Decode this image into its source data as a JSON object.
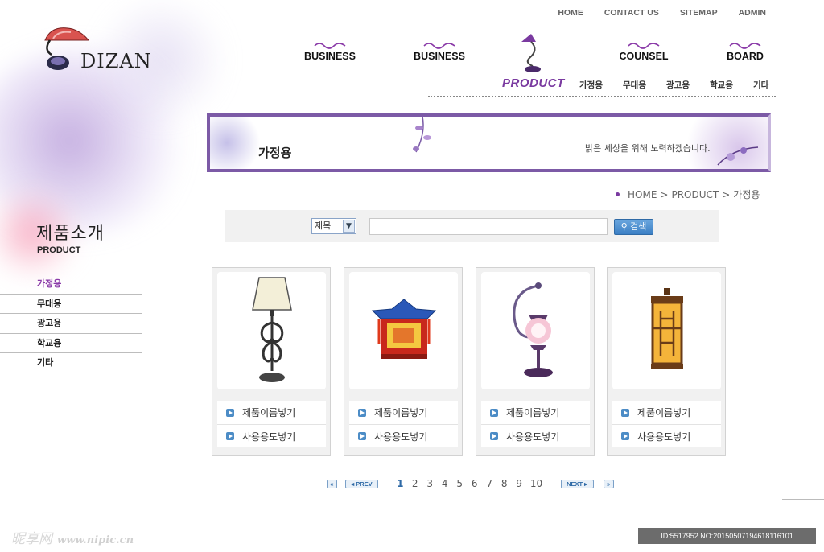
{
  "brand": {
    "name": "DIZAN"
  },
  "util_nav": [
    "HOME",
    "CONTACT US",
    "SITEMAP",
    "ADMIN"
  ],
  "main_nav": [
    "BUSINESS",
    "BUSINESS",
    "COUNSEL",
    "BOARD"
  ],
  "product_nav": {
    "label": "PRODUCT",
    "subitems": [
      "가정용",
      "무대용",
      "광고용",
      "학교용",
      "기타"
    ]
  },
  "banner": {
    "title": "가정용",
    "slogan": "밝은 세상을 위해 노력하겠습니다."
  },
  "breadcrumb": [
    "HOME",
    ">",
    "PRODUCT",
    ">",
    "가정용"
  ],
  "search": {
    "select_value": "제목",
    "button_label": "검색"
  },
  "sidebar": {
    "title": "제품소개",
    "subtitle": "PRODUCT",
    "items": [
      {
        "label": "가정용",
        "active": true
      },
      {
        "label": "무대용",
        "active": false
      },
      {
        "label": "광고용",
        "active": false
      },
      {
        "label": "학교용",
        "active": false
      },
      {
        "label": "기타",
        "active": false
      }
    ]
  },
  "products": [
    {
      "name": "제품이름넣기",
      "usage": "사용용도넣기",
      "icon": "floor-lamp-icon"
    },
    {
      "name": "제품이름넣기",
      "usage": "사용용도넣기",
      "icon": "lantern-icon"
    },
    {
      "name": "제품이름넣기",
      "usage": "사용용도넣기",
      "icon": "hanging-lamp-icon"
    },
    {
      "name": "제품이름넣기",
      "usage": "사용용도넣기",
      "icon": "wooden-lantern-icon"
    }
  ],
  "pagination": {
    "prev": "PREV",
    "next": "NEXT",
    "pages": [
      "1",
      "2",
      "3",
      "4",
      "5",
      "6",
      "7",
      "8",
      "9",
      "10"
    ],
    "current": "1"
  },
  "watermark": {
    "left": "昵享网",
    "left_url": "www.nipic.cn",
    "right": "ID:5517952 NO:20150507194618116101"
  },
  "colors": {
    "accent": "#7a3aa0",
    "button_blue": "#3b7fc4"
  }
}
